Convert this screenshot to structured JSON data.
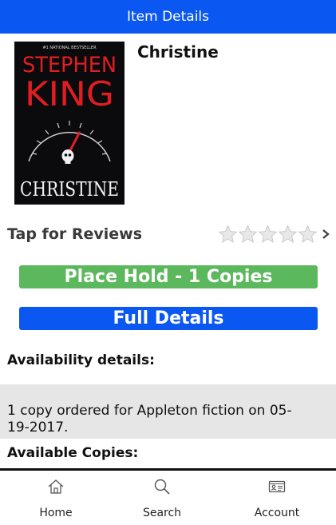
{
  "header": {
    "title": "Item Details"
  },
  "book": {
    "title": "Christine",
    "cover": {
      "badge": "#1 NATIONAL BESTSELLER",
      "author_line1": "STEPHEN",
      "author_line2": "KING",
      "title_art": "CHRISTINE"
    }
  },
  "reviews": {
    "label": "Tap for Reviews",
    "rating": 0,
    "max_rating": 5
  },
  "actions": {
    "place_hold": "Place Hold - 1 Copies",
    "full_details": "Full Details"
  },
  "availability": {
    "heading": "Availability details:",
    "text": "1 copy ordered for Appleton fiction on 05-19-2017."
  },
  "copies": {
    "heading": "Available Copies:"
  },
  "tabbar": {
    "items": [
      {
        "label": "Home",
        "icon": "home-icon"
      },
      {
        "label": "Search",
        "icon": "search-icon"
      },
      {
        "label": "Account",
        "icon": "account-card-icon"
      }
    ]
  },
  "colors": {
    "header": "#0a57f2",
    "place_hold": "#5cb85c",
    "full_details": "#0a57f2",
    "availability_bg": "#e6e6e6"
  }
}
